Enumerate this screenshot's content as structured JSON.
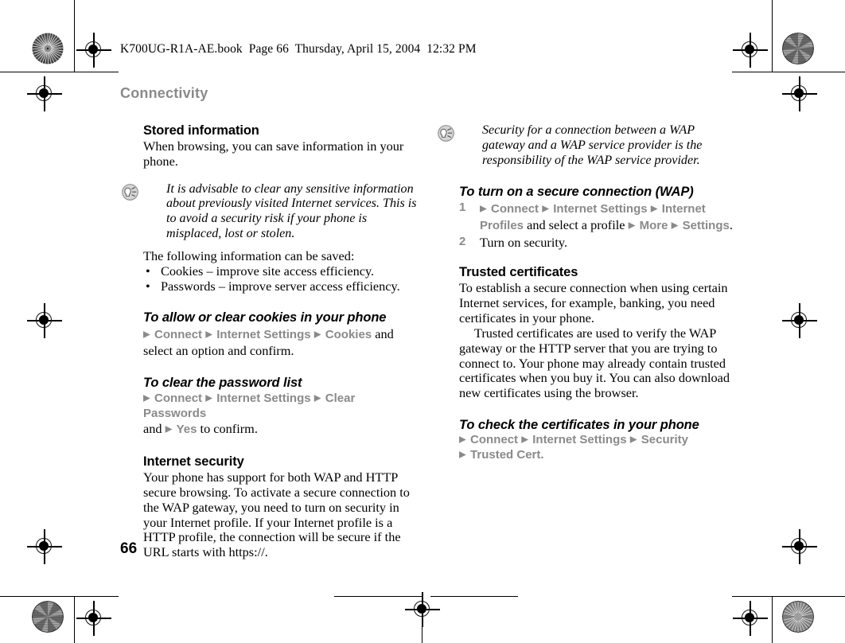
{
  "document": {
    "slug_line": "K700UG-R1A-AE.book  Page 66  Thursday, April 15, 2004  12:32 PM",
    "chapter_title": "Connectivity",
    "page_number": "66",
    "colors": {
      "menu_path_gray": "#8a8a8a",
      "chapter_title_gray": "#8a8a8a",
      "body_black": "#000000",
      "paper_white": "#ffffff"
    }
  },
  "left_column": {
    "stored_information": {
      "heading": "Stored information",
      "paragraph": "When browsing, you can save information in your phone."
    },
    "tip_note": {
      "icon": "tip-bulb-icon",
      "text": "It is advisable to clear any sensitive information about previously visited Internet services. This is to avoid a security risk if your phone is misplaced, lost or stolen."
    },
    "saved_info": {
      "lead_in": "The following information can be saved:",
      "bullet_char": "•",
      "items": [
        "Cookies – improve site access efficiency.",
        "Passwords – improve server access efficiency."
      ]
    },
    "allow_clear_cookies": {
      "heading": "To allow or clear cookies in your phone",
      "path_items": [
        "Connect",
        "Internet Settings",
        "Cookies"
      ],
      "trailing_text": " and select an option and confirm."
    },
    "clear_password_list": {
      "heading": "To clear the password list",
      "path_items": [
        "Connect",
        "Internet Settings",
        "Clear Passwords"
      ],
      "conjunction": "and ",
      "final_path_item": "Yes",
      "trailing_text": " to confirm."
    },
    "internet_security": {
      "heading": "Internet security",
      "paragraph": "Your phone has support for both WAP and HTTP secure browsing. To activate a secure connection to the WAP gateway, you need to turn on security in your Internet profile. If your Internet profile is a HTTP profile, the connection will be secure if the URL starts with https://."
    }
  },
  "right_column": {
    "tip_note": {
      "icon": "tip-bulb-icon",
      "text": "Security for a connection between a WAP gateway and a WAP service provider is the responsibility of the WAP service provider."
    },
    "turn_on_secure_connection": {
      "heading": "To turn on a secure connection (WAP)",
      "steps": [
        {
          "number": "1",
          "path_items": [
            "Connect",
            "Internet Settings",
            "Internet Profiles"
          ],
          "middle_text": " and select a profile ",
          "tail_path_items": [
            "More",
            "Settings"
          ],
          "trailing_text": "."
        },
        {
          "number": "2",
          "text": "Turn on security."
        }
      ]
    },
    "trusted_certificates": {
      "heading": "Trusted certificates",
      "paragraph_1": "To establish a secure connection when using certain Internet services, for example, banking, you need certificates in your phone.",
      "paragraph_2": "Trusted certificates are used to verify the WAP gateway or the HTTP server that you are trying to connect to. Your phone may already contain trusted certificates when you buy it. You can also download new certificates using the browser."
    },
    "check_certificates": {
      "heading": "To check the certificates in your phone",
      "path_items": [
        "Connect",
        "Internet Settings",
        "Security"
      ],
      "path_items_line2": [
        "Trusted Cert."
      ]
    }
  }
}
